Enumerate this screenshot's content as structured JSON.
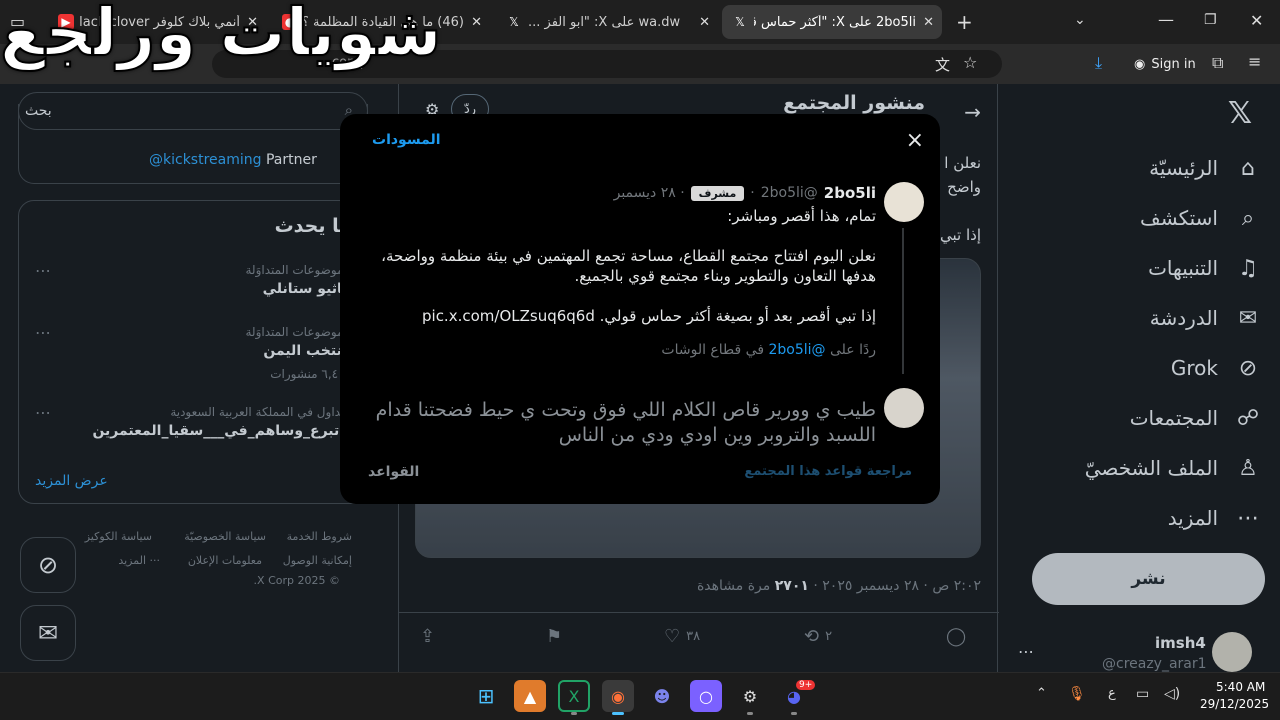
{
  "browser": {
    "tabs": [
      {
        "title": "أنمي بلاك كلوفر Black clover - ...",
        "favicon": "youtube-icon"
      },
      {
        "title": "(46) ما هي القيادة المظلمة ؟ - ...",
        "favicon": "app-icon"
      },
      {
        "title": "wa.dw على X: \"ابو الفز ...",
        "favicon": "x-icon"
      },
      {
        "title": "2bo5li على X: \"أكثر حماس قولي\" ...",
        "favicon": "x-icon"
      }
    ],
    "new_tab": "+",
    "sign_in": "Sign in",
    "address_partial": "comp"
  },
  "overlay_caption": "شويات ورلجع",
  "nav": {
    "items": [
      {
        "label": "الرئيسيّة",
        "icon": "home-icon"
      },
      {
        "label": "استكشف",
        "icon": "search-icon"
      },
      {
        "label": "التنبيهات",
        "icon": "bell-icon"
      },
      {
        "label": "الدردشة",
        "icon": "mail-icon"
      },
      {
        "label": "Grok",
        "icon": "grok-icon"
      },
      {
        "label": "المجتمعات",
        "icon": "communities-icon"
      },
      {
        "label": "الملف الشخصيّ",
        "icon": "profile-icon"
      },
      {
        "label": "المزيد",
        "icon": "more-icon"
      }
    ],
    "post_button": "نشر",
    "account": {
      "name": "imsh4",
      "handle": "@creazy_arar1"
    }
  },
  "main": {
    "header_title": "منشور المجتمع",
    "header_btn": "ردّ",
    "snippet_lines": [
      "نعلن ا",
      "واضح",
      "إذا تبي"
    ],
    "stats": {
      "time": "٢:٠٢ ص · ٢٨ ديسمبر ٢٠٢٥ · ",
      "views": "٢٧٠١",
      "views_label": " مرة مشاهدة"
    },
    "actions": {
      "likes": "٣٨",
      "reposts": "٢"
    }
  },
  "sidebar": {
    "search_placeholder": "بحث",
    "partner_text": "Partner",
    "partner_link": "@kickstreaming",
    "trends_title": "ما يحدث",
    "trends": [
      {
        "meta": "الموضوعات المتداوَلة",
        "name": "ماثيو ستانلي",
        "posts": ""
      },
      {
        "meta": "الموضوعات المتداوَلة",
        "name": "منتخب اليمن",
        "posts": "٦,٤٠٠ منشورات"
      },
      {
        "meta": "متداول في المملكة العربية السعودية",
        "name": "#تبرع_وساهم_في___سقيا_المعتمرين",
        "posts": ""
      }
    ],
    "show_more": "عرض المزيد",
    "footer": [
      "شروط الخدمة",
      "سياسة الخصوصيّة",
      "سياسة الكوكيز",
      "إمكانية الوصول",
      "معلومات الإعلان",
      "··· المزيد",
      "© 2025 X Corp."
    ]
  },
  "modal": {
    "drafts": "المسودات",
    "close": "×",
    "post": {
      "author": "2bo5li",
      "handle": "@2bo5li",
      "badge": "مشرف",
      "date": "· ٢٨ ديسمبر",
      "text1": "تمام، هذا أقصر ومباشر:",
      "text2": "نعلن اليوم افتتاح مجتمع القطاع، مساحة تجمع المهتمين في بيئة منظمة وواضحة، هدفها التعاون والتطوير وبناء مجتمع قوي بالجميع.",
      "text3": "إذا تبي أقصر بعد أو بصيغة أكثر حماس قولي. pic.x.com/OLZsuq6q6d",
      "reply_prefix": "ردًا على",
      "reply_handle": "@2bo5li",
      "reply_suffix": "في قطاع الوشات"
    },
    "draft_text": "طيب ي وورير قاص الكلام اللي فوق وتحت ي حيط فضحتنا قدام اللسبد والتروبر  وين اودي ودي من الناس",
    "rules_review": "مراجعة قواعد هذا المجتمع",
    "rules": "القواعد"
  },
  "taskbar": {
    "lang": "ع",
    "time": "5:40 AM",
    "date": "29/12/2025",
    "badge": "9+"
  },
  "colors": {
    "accent": "#1d9bf0",
    "bg": "#000000",
    "muted": "#71767b"
  }
}
